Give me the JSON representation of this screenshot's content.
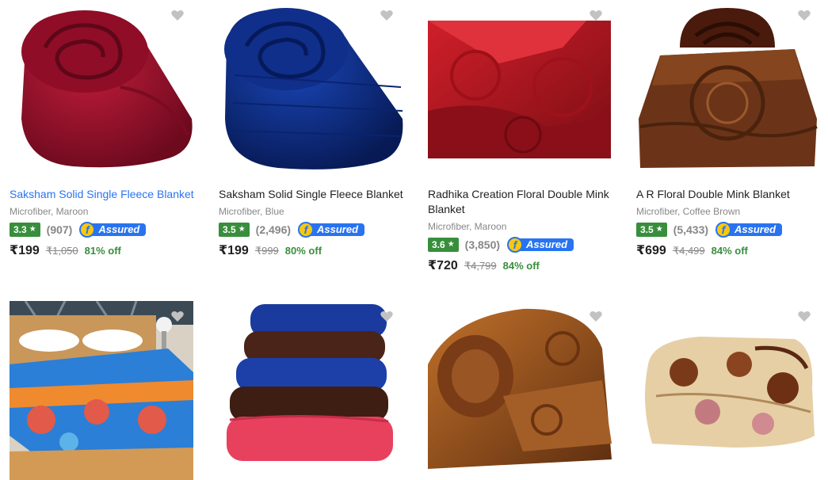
{
  "products": [
    {
      "title": "Saksham Solid Single Fleece Blanket",
      "subtitle": "Microfiber, Maroon",
      "rating": "3.3",
      "reviews": "(907)",
      "assured": "Assured",
      "price": "₹199",
      "mrp": "₹1,050",
      "off": "81% off",
      "color": "#a3112e"
    },
    {
      "title": "Saksham Solid Single Fleece Blanket",
      "subtitle": "Microfiber, Blue",
      "rating": "3.5",
      "reviews": "(2,496)",
      "assured": "Assured",
      "price": "₹199",
      "mrp": "₹999",
      "off": "80% off",
      "color": "#0c2f8c"
    },
    {
      "title": "Radhika Creation Floral Double Mink Blanket",
      "subtitle": "Microfiber, Maroon",
      "rating": "3.6",
      "reviews": "(3,850)",
      "assured": "Assured",
      "price": "₹720",
      "mrp": "₹4,799",
      "off": "84% off",
      "color": "#b0141e"
    },
    {
      "title": "A R Floral Double Mink Blanket",
      "subtitle": "Microfiber, Coffee Brown",
      "rating": "3.5",
      "reviews": "(5,433)",
      "assured": "Assured",
      "price": "₹699",
      "mrp": "₹4,499",
      "off": "84% off",
      "color": "#5a2a14"
    }
  ],
  "star_glyph": "★",
  "assured_letter": "f",
  "colors": {
    "rating_green": "#388e3c",
    "link_blue": "#2874f0",
    "assured_blue": "#2874f0",
    "heart_grey": "#c2c2c2"
  }
}
